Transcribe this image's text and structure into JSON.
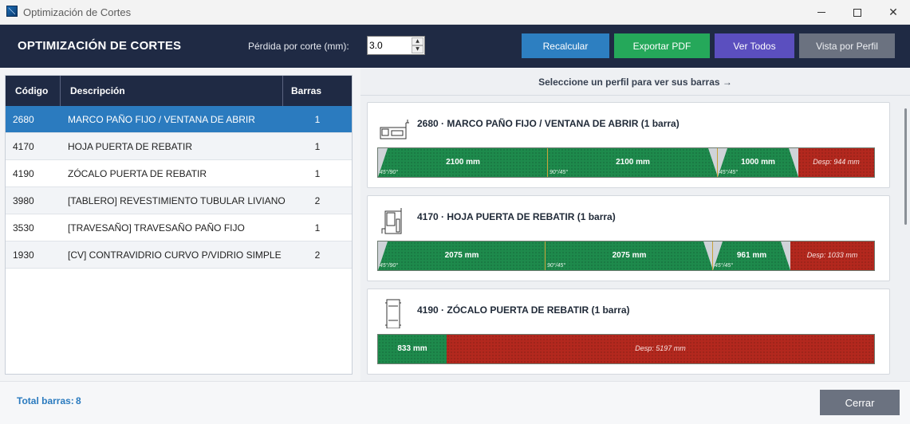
{
  "window": {
    "title": "Optimización de Cortes",
    "controls": {
      "minimize": "",
      "maximize": "",
      "close": "✕"
    }
  },
  "header": {
    "title": "OPTIMIZACIÓN DE CORTES",
    "loss_label": "Pérdida por corte (mm):",
    "loss_value": "3.0",
    "buttons": {
      "recalc": "Recalcular",
      "export_pdf": "Exportar PDF",
      "view_all": "Ver Todos",
      "view_profile": "Vista por Perfil"
    }
  },
  "table": {
    "columns": [
      "Código",
      "Descripción",
      "Barras"
    ],
    "rows": [
      {
        "code": "2680",
        "desc": "MARCO PAÑO FIJO / VENTANA DE ABRIR",
        "bars": "1",
        "selected": true
      },
      {
        "code": "4170",
        "desc": "HOJA PUERTA DE REBATIR",
        "bars": "1"
      },
      {
        "code": "4190",
        "desc": "ZÓCALO PUERTA DE REBATIR",
        "bars": "1"
      },
      {
        "code": "3980",
        "desc": "[TABLERO] REVESTIMIENTO TUBULAR LIVIANO",
        "bars": "2"
      },
      {
        "code": "3530",
        "desc": "[TRAVESAÑO] TRAVESAÑO PAÑO FIJO",
        "bars": "1"
      },
      {
        "code": "1930",
        "desc": "[CV] CONTRAVIDRIO CURVO P/VIDRIO SIMPLE",
        "bars": "2"
      }
    ]
  },
  "right": {
    "hint": "Seleccione un perfil para ver sus barras →",
    "cards": [
      {
        "title": "2680  ·  MARCO PAÑO FIJO / VENTANA DE ABRIR  (1 barra)",
        "icon": "profile-2680-icon",
        "bar_total_mm": 6144,
        "cuts": [
          {
            "label": "2100 mm",
            "mm": 2100,
            "angle": "45°/90°"
          },
          {
            "label": "2100 mm",
            "mm": 2100,
            "angle": "90°/45°"
          },
          {
            "label": "1000 mm",
            "mm": 1000,
            "angle": "45°/45°"
          }
        ],
        "waste": {
          "label": "Desp: 944 mm",
          "mm": 944
        }
      },
      {
        "title": "4170  ·  HOJA PUERTA DE REBATIR  (1 barra)",
        "icon": "profile-4170-icon",
        "bar_total_mm": 6144,
        "cuts": [
          {
            "label": "2075 mm",
            "mm": 2075,
            "angle": "45°/90°"
          },
          {
            "label": "2075 mm",
            "mm": 2075,
            "angle": "90°/45°"
          },
          {
            "label": "961 mm",
            "mm": 961,
            "angle": "45°/45°"
          }
        ],
        "waste": {
          "label": "Desp: 1033 mm",
          "mm": 1033
        }
      },
      {
        "title": "4190  ·  ZÓCALO PUERTA DE REBATIR  (1 barra)",
        "icon": "profile-4190-icon",
        "bar_total_mm": 6030,
        "cuts": [
          {
            "label": "833 mm",
            "mm": 833,
            "angle": ""
          }
        ],
        "waste": {
          "label": "Desp: 5197 mm",
          "mm": 5197
        }
      }
    ]
  },
  "footer": {
    "total_label": "Total barras:",
    "total_value": "8",
    "close_button": "Cerrar"
  },
  "colors": {
    "header_bg": "#1f2a44",
    "accent_blue": "#2b7bbf",
    "cut_green": "#1e8a4c",
    "waste_red": "#b3281e",
    "pdf_green": "#25a85a",
    "purple": "#5b4fbf",
    "gray": "#6b7280"
  }
}
